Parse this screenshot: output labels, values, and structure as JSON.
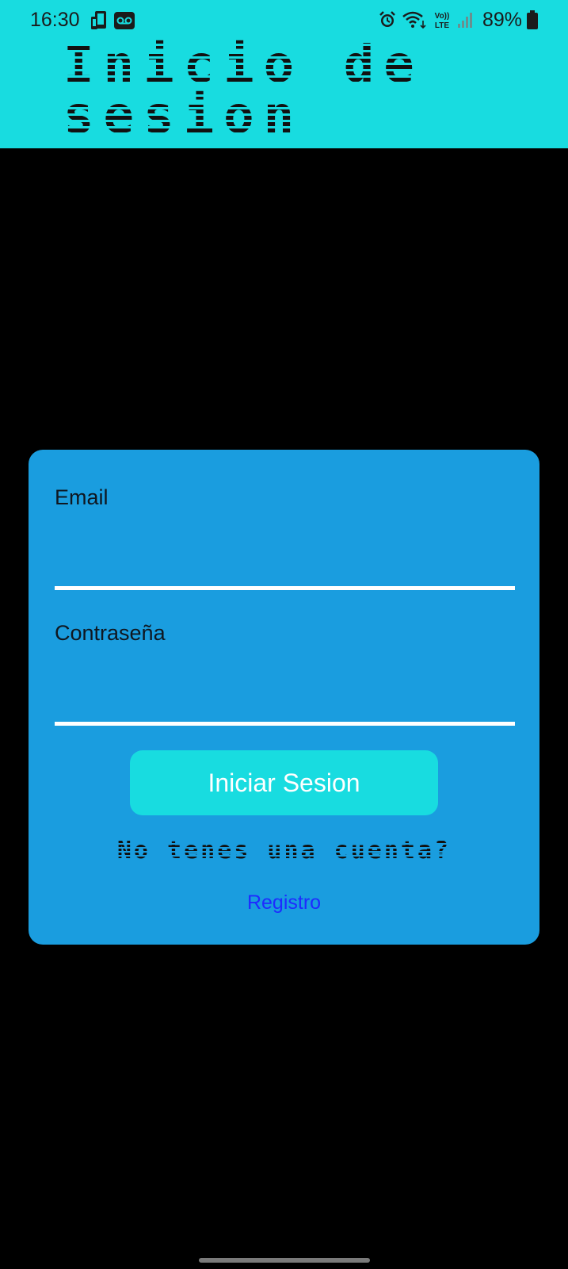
{
  "status_bar": {
    "time": "16:30",
    "battery": "89%",
    "volte_label": "Vo)) LTE",
    "left_icons": [
      "phone-link-icon",
      "voicemail-icon"
    ],
    "right_icons": [
      "alarm-icon",
      "wifi-icon",
      "volte-icon",
      "signal-icon",
      "battery-icon"
    ]
  },
  "header": {
    "title": "Inicio de sesion",
    "background_color": "#18DCE0"
  },
  "login_form": {
    "email_label": "Email",
    "email_value": "",
    "password_label": "Contraseña",
    "password_value": "",
    "submit_label": "Iniciar Sesion",
    "no_account_text": "No tenes una cuenta?",
    "register_link": "Registro",
    "card_color": "#1A9DDF",
    "button_color": "#18DCE0",
    "link_color": "#1E2BFF"
  },
  "navigation": {
    "home_indicator": "home-indicator-icon"
  }
}
